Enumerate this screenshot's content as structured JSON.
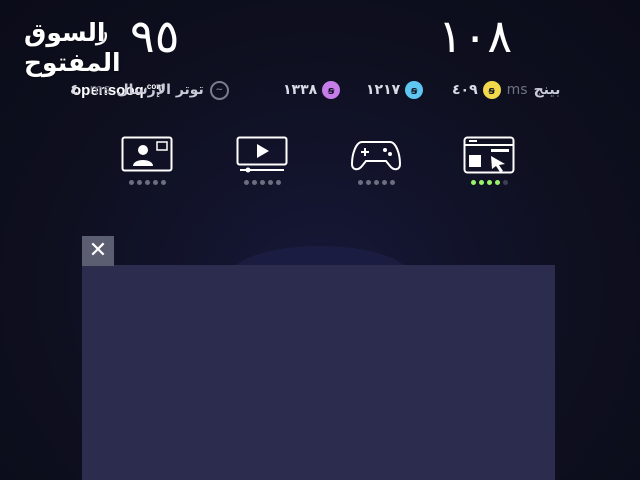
{
  "header": {
    "download_value": "١٠٨",
    "upload_value": "٩٥",
    "upload_unit": "ر",
    "brand_ar": "السوق المفتوح",
    "brand_en": "opensooq",
    "brand_en_suffix": ".com"
  },
  "stats": {
    "ping_label": "بينج",
    "ping_unit": "ms",
    "ping_value": "٤٠٩",
    "ping_icon": "yellow-coin-icon",
    "server_a_value": "١٢١٧",
    "server_a_icon": "blue-coin-icon",
    "server_b_value": "١٣٣٨",
    "server_b_icon": "purple-coin-icon",
    "jitter_label": "توتر الإرسال",
    "jitter_unit": "ms",
    "jitter_value": "٤"
  },
  "modes": [
    {
      "name": "browsing",
      "icon": "browser-cursor-icon",
      "active_level": 4,
      "dots": 5
    },
    {
      "name": "gaming",
      "icon": "gamepad-icon",
      "active_level": 0,
      "dots": 5
    },
    {
      "name": "video",
      "icon": "video-play-icon",
      "active_level": 0,
      "dots": 5
    },
    {
      "name": "video-call",
      "icon": "video-call-icon",
      "active_level": 0,
      "dots": 5
    }
  ],
  "colors": {
    "background": "#0e0f1f",
    "panel": "#2c2d4e",
    "active_dot": "#9af46a",
    "inactive_dot": "#6d6f80",
    "close_button": "#5b5d70",
    "ping_coin": "#f1d94b",
    "server_a_coin": "#5ec6f0",
    "server_b_coin": "#c67dea"
  },
  "overlay": {
    "close_icon": "close-icon",
    "close_glyph": "✕"
  }
}
